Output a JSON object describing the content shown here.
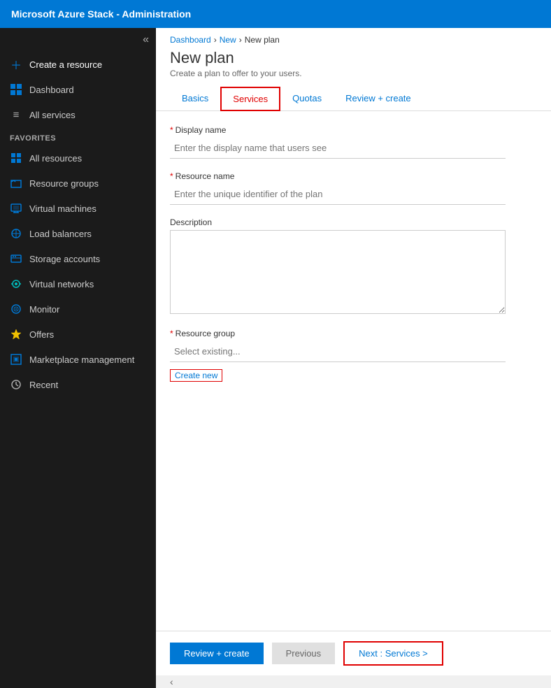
{
  "topbar": {
    "title": "Microsoft Azure Stack - Administration"
  },
  "sidebar": {
    "collapse_icon": "«",
    "items": [
      {
        "id": "create-resource",
        "label": "Create a resource",
        "icon": "+"
      },
      {
        "id": "dashboard",
        "label": "Dashboard",
        "icon": "▦"
      },
      {
        "id": "all-services",
        "label": "All services",
        "icon": "≡"
      }
    ],
    "favorites_label": "FAVORITES",
    "favorites": [
      {
        "id": "all-resources",
        "label": "All resources",
        "icon": "▦"
      },
      {
        "id": "resource-groups",
        "label": "Resource groups",
        "icon": "◈"
      },
      {
        "id": "virtual-machines",
        "label": "Virtual machines",
        "icon": "⬛"
      },
      {
        "id": "load-balancers",
        "label": "Load balancers",
        "icon": "⚙"
      },
      {
        "id": "storage-accounts",
        "label": "Storage accounts",
        "icon": "▬"
      },
      {
        "id": "virtual-networks",
        "label": "Virtual networks",
        "icon": "⊕"
      },
      {
        "id": "monitor",
        "label": "Monitor",
        "icon": "◉"
      },
      {
        "id": "offers",
        "label": "Offers",
        "icon": "✦"
      },
      {
        "id": "marketplace-management",
        "label": "Marketplace management",
        "icon": "⬒"
      },
      {
        "id": "recent",
        "label": "Recent",
        "icon": "⏱"
      }
    ]
  },
  "breadcrumb": {
    "items": [
      "Dashboard",
      "New",
      "New plan"
    ],
    "separators": [
      ">",
      ">"
    ]
  },
  "page": {
    "title": "New plan",
    "subtitle": "Create a plan to offer to your users."
  },
  "tabs": [
    {
      "id": "basics",
      "label": "Basics",
      "active": false
    },
    {
      "id": "services",
      "label": "Services",
      "active": true
    },
    {
      "id": "quotas",
      "label": "Quotas",
      "active": false
    },
    {
      "id": "review-create",
      "label": "Review + create",
      "active": false
    }
  ],
  "form": {
    "display_name_label": "Display name",
    "display_name_placeholder": "Enter the display name that users see",
    "resource_name_label": "Resource name",
    "resource_name_placeholder": "Enter the unique identifier of the plan",
    "description_label": "Description",
    "resource_group_label": "Resource group",
    "resource_group_placeholder": "Select existing...",
    "create_new_label": "Create new"
  },
  "footer": {
    "review_create_label": "Review + create",
    "previous_label": "Previous",
    "next_label": "Next : Services >"
  }
}
